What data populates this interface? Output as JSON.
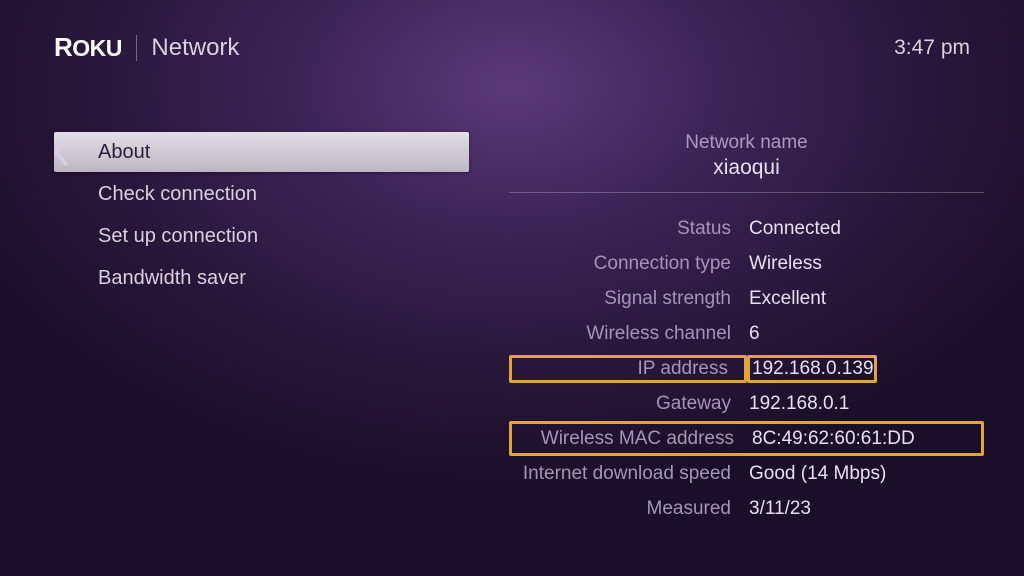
{
  "header": {
    "logo_text": "ROKU",
    "page_title": "Network",
    "clock": "3:47 pm"
  },
  "menu": {
    "items": [
      {
        "label": "About",
        "selected": true
      },
      {
        "label": "Check connection",
        "selected": false
      },
      {
        "label": "Set up connection",
        "selected": false
      },
      {
        "label": "Bandwidth saver",
        "selected": false
      }
    ]
  },
  "details": {
    "network_name_label": "Network name",
    "network_name_value": "xiaoqui",
    "rows": [
      {
        "label": "Status",
        "value": "Connected",
        "highlight": false
      },
      {
        "label": "Connection type",
        "value": "Wireless",
        "highlight": false
      },
      {
        "label": "Signal strength",
        "value": "Excellent",
        "highlight": false
      },
      {
        "label": "Wireless channel",
        "value": "6",
        "highlight": false
      },
      {
        "label": "IP address",
        "value": "192.168.0.139",
        "highlight": true
      },
      {
        "label": "Gateway",
        "value": "192.168.0.1",
        "highlight": false
      },
      {
        "label": "Wireless MAC address",
        "value": "8C:49:62:60:61:DD",
        "highlight": true
      },
      {
        "label": "Internet download speed",
        "value": "Good (14 Mbps)",
        "highlight": false
      },
      {
        "label": "Measured",
        "value": "3/11/23",
        "highlight": false
      }
    ]
  }
}
